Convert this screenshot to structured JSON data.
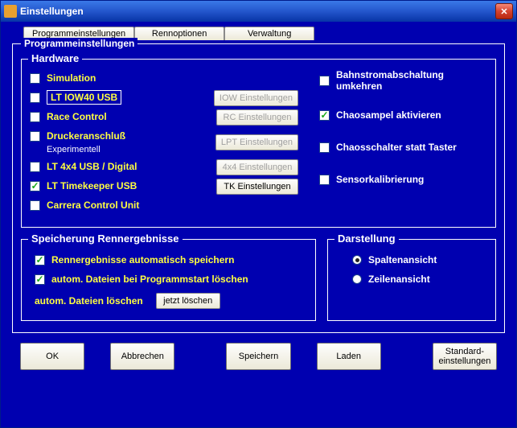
{
  "title": "Einstellungen",
  "tabs": {
    "t0": "Programmeinstellungen",
    "t1": "Rennoptionen",
    "t2": "Verwaltung"
  },
  "group_program": "Programmeinstellungen",
  "group_hardware": "Hardware",
  "hw": {
    "simulation": "Simulation",
    "iow40": "LT IOW40 USB",
    "race_control": "Race Control",
    "drucker": "Druckeranschluß",
    "drucker_sub": "Experimentell",
    "lt4x4": "LT 4x4 USB / Digital",
    "timekeeper": "LT Timekeeper USB",
    "carrera": "Carrera Control Unit",
    "btn_iow": "IOW Einstellungen",
    "btn_rc": "RC Einstellungen",
    "btn_lpt": "LPT Einstellungen",
    "btn_4x4": "4x4 Einstellungen",
    "btn_tk": "TK Einstellungen"
  },
  "opts": {
    "bahnstrom": "Bahnstromabschaltung umkehren",
    "chaosampel": "Chaosampel aktivieren",
    "chaosschalter": "Chaosschalter statt Taster",
    "sensorkal": "Sensorkalibrierung"
  },
  "group_storage": "Speicherung Rennergebnisse",
  "storage": {
    "autosave": "Rennergebnisse automatisch speichern",
    "autodel_start": "autom. Dateien bei Programmstart löschen",
    "autodel": "autom. Dateien löschen",
    "btn_delnow": "jetzt löschen"
  },
  "group_view": "Darstellung",
  "view": {
    "col": "Spaltenansicht",
    "row": "Zeilenansicht"
  },
  "buttons": {
    "ok": "OK",
    "cancel": "Abbrechen",
    "save": "Speichern",
    "load": "Laden",
    "defaults": "Standard-\neinstellungen"
  }
}
